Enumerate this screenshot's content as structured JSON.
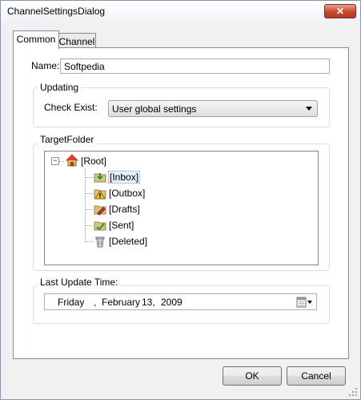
{
  "window": {
    "title": "ChannelSettingsDialog",
    "close_glyph": "✕"
  },
  "tabs": [
    {
      "label": "Common"
    },
    {
      "label": "Channel"
    }
  ],
  "name_field": {
    "label": "Name:",
    "value": "Softpedia"
  },
  "updating": {
    "caption": "Updating",
    "check_exist_label": "Check Exist:",
    "check_exist_value": "User global settings"
  },
  "target_folder": {
    "caption": "TargetFolder",
    "root": "[Root]",
    "items": [
      "[Inbox]",
      "[Outbox]",
      "[Drafts]",
      "[Sent]",
      "[Deleted]"
    ],
    "icons": [
      "home-icon",
      "inbox-folder-icon",
      "outbox-folder-icon",
      "drafts-folder-icon",
      "sent-folder-icon",
      "trash-can-icon"
    ]
  },
  "last_update": {
    "caption": "Last Update Time:",
    "weekday": "Friday",
    "separator": ",",
    "month": "February",
    "day": "13,",
    "year": "2009"
  },
  "buttons": {
    "ok": "OK",
    "cancel": "Cancel"
  },
  "colors": {
    "close_button": "#c8452c",
    "panel_border": "#898c95",
    "selection_border": "#7da2ce"
  }
}
